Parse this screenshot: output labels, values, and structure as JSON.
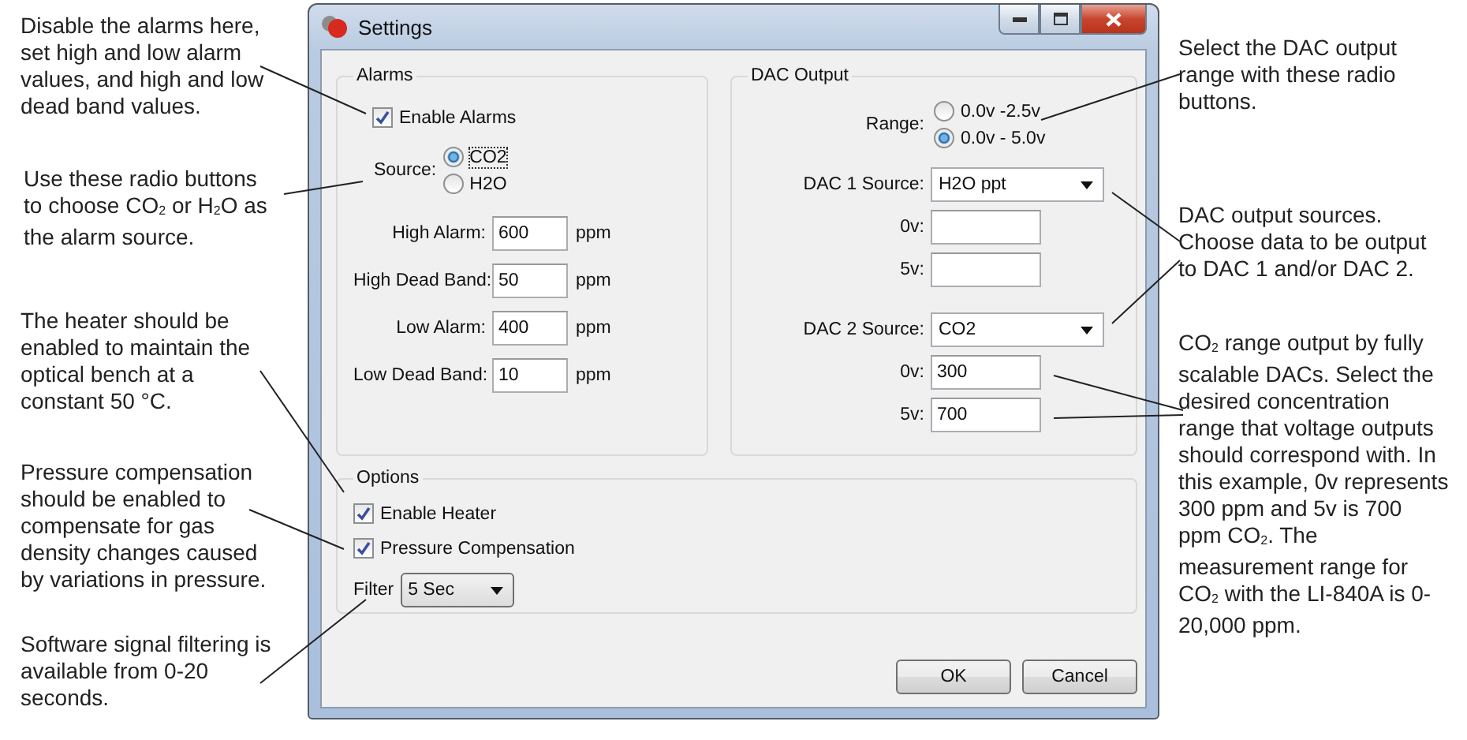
{
  "window": {
    "title": "Settings"
  },
  "alarms": {
    "title": "Alarms",
    "enable": {
      "label": "Enable Alarms",
      "checked": true
    },
    "source_label": "Source:",
    "sources": [
      {
        "label": "CO2",
        "selected": true
      },
      {
        "label": "H2O",
        "selected": false
      }
    ],
    "fields": [
      {
        "label": "High Alarm:",
        "value": "600",
        "unit": "ppm"
      },
      {
        "label": "High Dead Band:",
        "value": "50",
        "unit": "ppm"
      },
      {
        "label": "Low Alarm:",
        "value": "400",
        "unit": "ppm"
      },
      {
        "label": "Low Dead Band:",
        "value": "10",
        "unit": "ppm"
      }
    ]
  },
  "dac_output": {
    "title": "DAC Output",
    "range_label": "Range:",
    "ranges": [
      {
        "label": "0.0v -2.5v",
        "selected": false
      },
      {
        "label": "0.0v - 5.0v",
        "selected": true
      }
    ],
    "dacs": [
      {
        "label": "DAC 1 Source:",
        "value": "H2O ppt",
        "fields": [
          {
            "label": "0v:"
          },
          {
            "label": "5v:"
          }
        ]
      },
      {
        "label": "DAC 2 Source:",
        "value": "CO2",
        "fields": [
          {
            "label": "0v:",
            "value": "300"
          },
          {
            "label": "5v:",
            "value": "700"
          }
        ]
      }
    ]
  },
  "options": {
    "title": "Options",
    "checks": [
      {
        "label": "Enable Heater",
        "checked": true
      },
      {
        "label": "Pressure Compensation",
        "checked": true
      }
    ],
    "filter_label": "Filter",
    "filter_value": "5 Sec"
  },
  "buttons": [
    {
      "label": "OK"
    },
    {
      "label": "Cancel"
    }
  ],
  "annotations_left": [
    "Disable the alarms here, set high and low alarm values, and high and low dead band values.",
    "Use these radio buttons to choose CO$_{2}$ or H$_{2}$O as the alarm source.",
    "The heater should be enabled to maintain the optical bench at a constant 50 °C.",
    "Pressure compensation should be enabled to compensate for gas density changes caused by variations in pressure.",
    "Software signal filtering is available from 0-20 seconds."
  ],
  "annotations_right": [
    "Select the DAC output range with these radio buttons.",
    "DAC output sources. Choose data to be output to DAC 1 and/or DAC 2.",
    "CO$_{2}$ range output by fully scalable DACs. Select the desired concentration range that voltage outputs should correspond with. In this example, 0v represents 300 ppm and 5v is 700 ppm CO$_{2}$. The measurement range for CO$_{2}$ with the LI-840A is 0-20,000 ppm."
  ]
}
